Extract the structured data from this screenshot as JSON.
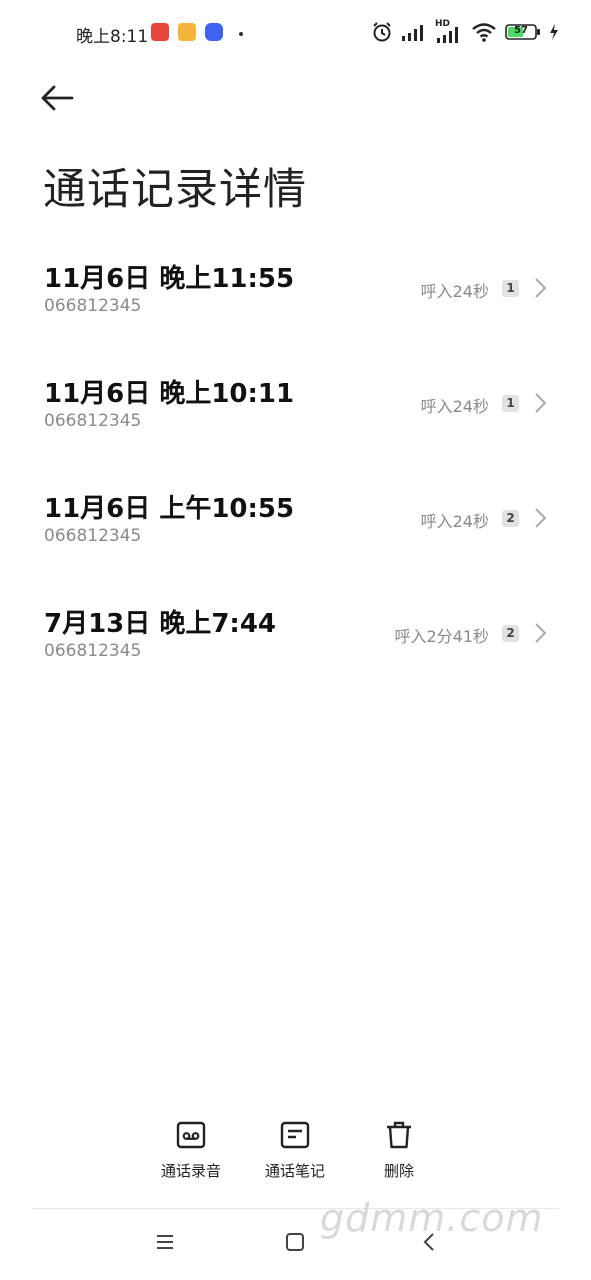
{
  "status_bar": {
    "time": "晚上8:11",
    "battery": "57",
    "network": "HD"
  },
  "page_title": "通话记录详情",
  "calls": [
    {
      "time": "11月6日 晚上11:55",
      "number": "066812345",
      "duration": "呼入24秒",
      "sim": "1"
    },
    {
      "time": "11月6日 晚上10:11",
      "number": "066812345",
      "duration": "呼入24秒",
      "sim": "1"
    },
    {
      "time": "11月6日 上午10:55",
      "number": "066812345",
      "duration": "呼入24秒",
      "sim": "2"
    },
    {
      "time": "7月13日 晚上7:44",
      "number": "066812345",
      "duration": "呼入2分41秒",
      "sim": "2"
    }
  ],
  "actions": {
    "recording_label": "通话录音",
    "notes_label": "通话笔记",
    "delete_label": "删除"
  },
  "watermark": "gdmm.com",
  "icons": {
    "back": "arrow-left-icon",
    "chevron": "chevron-right-icon",
    "recording": "voicemail-icon",
    "notes": "note-icon",
    "delete": "trash-icon",
    "nav_menu": "menu-icon",
    "nav_home": "home-square-icon",
    "nav_back": "back-chevron-icon"
  }
}
